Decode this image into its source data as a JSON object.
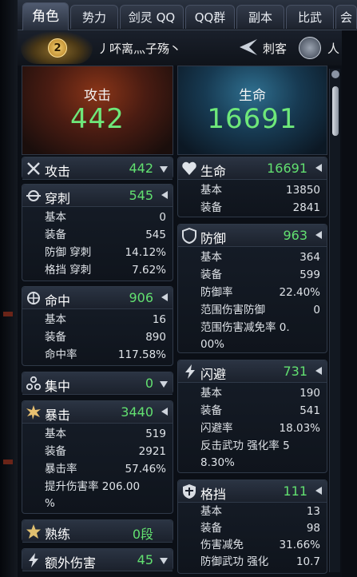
{
  "tabs": [
    "角色",
    "势力",
    "剑灵 QQ",
    "QQ群",
    "副本",
    "比武",
    "会"
  ],
  "player": {
    "level": "2",
    "name": "丿吥离灬子殇丶",
    "class": "刺客",
    "race": "人"
  },
  "summary": {
    "attack": {
      "title": "攻击",
      "value": "442"
    },
    "hp": {
      "title": "生命",
      "value": "16691"
    }
  },
  "left": {
    "attack": {
      "label": "攻击",
      "value": "442"
    },
    "pierce": {
      "label": "穿刺",
      "value": "545",
      "rows": [
        [
          "基本",
          "0"
        ],
        [
          "装备",
          "545"
        ],
        [
          "防御 穿刺",
          "14.12%"
        ],
        [
          "格挡 穿刺",
          "7.62%"
        ]
      ]
    },
    "accuracy": {
      "label": "命中",
      "value": "906",
      "rows": [
        [
          "基本",
          "16"
        ],
        [
          "装备",
          "890"
        ],
        [
          "命中率",
          "117.58%"
        ]
      ]
    },
    "focus": {
      "label": "集中",
      "value": "0"
    },
    "crit": {
      "label": "暴击",
      "value": "3440",
      "rows": [
        [
          "基本",
          "519"
        ],
        [
          "装备",
          "2921"
        ],
        [
          "暴击率",
          "57.46%"
        ]
      ],
      "extra_line1": "提升伤害率 206.00",
      "extra_line2": "%"
    },
    "mastery": {
      "label": "熟练",
      "value": "0段"
    },
    "extra_damage": {
      "label": "额外伤害",
      "value": "45"
    }
  },
  "right": {
    "hp": {
      "label": "生命",
      "value": "16691",
      "rows": [
        [
          "基本",
          "13850"
        ],
        [
          "装备",
          "2841"
        ]
      ]
    },
    "defense": {
      "label": "防御",
      "value": "963",
      "rows": [
        [
          "基本",
          "364"
        ],
        [
          "装备",
          "599"
        ],
        [
          "防御率",
          "22.40%"
        ],
        [
          "范围伤害防御",
          "0"
        ]
      ],
      "extra_line1": "范围伤害减免率 0.",
      "extra_line2": "00%"
    },
    "evasion": {
      "label": "闪避",
      "value": "731",
      "rows": [
        [
          "基本",
          "190"
        ],
        [
          "装备",
          "541"
        ],
        [
          "闪避率",
          "18.03%"
        ]
      ],
      "extra_line1": "反击武功 强化率 5",
      "extra_line2": "8.30%"
    },
    "block": {
      "label": "格挡",
      "value": "111",
      "rows": [
        [
          "基本",
          "13"
        ],
        [
          "装备",
          "98"
        ],
        [
          "伤害减免",
          "31.66%"
        ],
        [
          "防御武功 强化",
          "10.7"
        ]
      ]
    }
  },
  "colors": {
    "value_green": "#62e070",
    "big_green": "#6ee87a"
  }
}
